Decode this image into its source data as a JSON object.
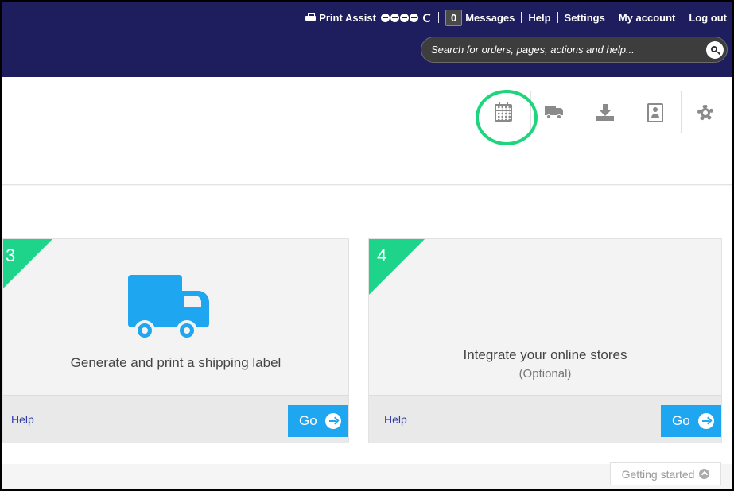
{
  "topnav": {
    "print_assist": "Print Assist",
    "message_count": "0",
    "messages": "Messages",
    "help": "Help",
    "settings": "Settings",
    "my_account": "My account",
    "log_out": "Log out"
  },
  "search": {
    "placeholder": "Search for orders, pages, actions and help..."
  },
  "toolbar": {
    "icons": [
      "calendar-icon",
      "truck-icon",
      "download-icon",
      "address-book-icon",
      "gear-icon"
    ]
  },
  "cards": [
    {
      "number": "3",
      "title": "Generate and print a shipping label",
      "subtitle": "",
      "help": "Help",
      "go": "Go"
    },
    {
      "number": "4",
      "title": "Integrate your online stores",
      "subtitle": "(Optional)",
      "help": "Help",
      "go": "Go"
    }
  ],
  "getting_started": "Getting started",
  "colors": {
    "header": "#1e1d5e",
    "accent_blue": "#1ea6f0",
    "accent_green": "#1ed48a",
    "highlight_ring": "#1ed47c"
  }
}
